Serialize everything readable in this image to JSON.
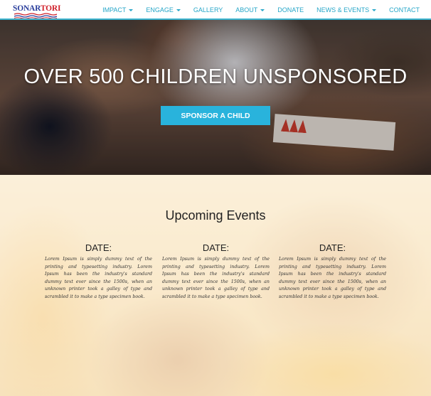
{
  "brand": {
    "logo_text_a": "SONAR",
    "logo_text_b": "TORI",
    "accent": "#29b3dc"
  },
  "nav": {
    "items": [
      {
        "label": "IMPACT",
        "dropdown": true
      },
      {
        "label": "ENGAGE",
        "dropdown": true
      },
      {
        "label": "GALLERY",
        "dropdown": false
      },
      {
        "label": "ABOUT",
        "dropdown": true
      },
      {
        "label": "DONATE",
        "dropdown": false
      },
      {
        "label": "NEWS & EVENTS",
        "dropdown": true
      },
      {
        "label": "CONTACT",
        "dropdown": false
      }
    ]
  },
  "hero": {
    "title": "OVER 500 CHILDREN UNSPONSORED",
    "button_label": "SPONSOR A CHILD"
  },
  "events": {
    "title": "Upcoming Events",
    "items": [
      {
        "date_label": "DATE:",
        "text": "Lorem Ipsum is simply dummy text of the printing and typesetting industry. Lorem Ipsum has been the industry's standard dummy text ever since the 1500s, when an unknown printer took a galley of type and scrambled it to make a type specimen book."
      },
      {
        "date_label": "DATE:",
        "text": "Lorem Ipsum is simply dummy text of the printing and typesetting industry. Lorem Ipsum has been the industry's standard dummy text ever since the 1500s, when an unknown printer took a galley of type and scrambled it to make a type specimen book."
      },
      {
        "date_label": "DATE:",
        "text": "Lorem Ipsum is simply dummy text of the printing and typesetting industry. Lorem Ipsum has been the industry's standard dummy text ever since the 1500s, when an unknown printer took a galley of type and scrambled it to make a type specimen book."
      }
    ]
  }
}
